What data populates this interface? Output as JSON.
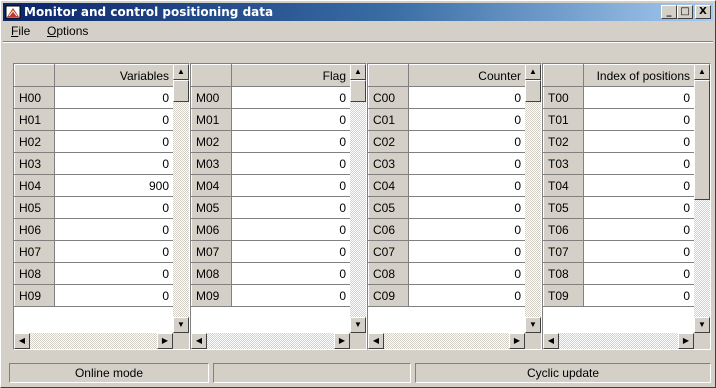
{
  "window": {
    "title": "Monitor and control positioning data",
    "minimize_label": "_",
    "maximize_label": "□",
    "close_label": "X"
  },
  "menu": {
    "file_mnemonic": "F",
    "file_rest": "ile",
    "options_mnemonic": "O",
    "options_rest": "ptions"
  },
  "panels": [
    {
      "header": "Variables",
      "rows": [
        {
          "label": "H00",
          "value": "0"
        },
        {
          "label": "H01",
          "value": "0"
        },
        {
          "label": "H02",
          "value": "0"
        },
        {
          "label": "H03",
          "value": "0"
        },
        {
          "label": "H04",
          "value": "900"
        },
        {
          "label": "H05",
          "value": "0"
        },
        {
          "label": "H06",
          "value": "0"
        },
        {
          "label": "H07",
          "value": "0"
        },
        {
          "label": "H08",
          "value": "0"
        },
        {
          "label": "H09",
          "value": "0"
        }
      ]
    },
    {
      "header": "Flag",
      "rows": [
        {
          "label": "M00",
          "value": "0"
        },
        {
          "label": "M01",
          "value": "0"
        },
        {
          "label": "M02",
          "value": "0"
        },
        {
          "label": "M03",
          "value": "0"
        },
        {
          "label": "M04",
          "value": "0"
        },
        {
          "label": "M05",
          "value": "0"
        },
        {
          "label": "M06",
          "value": "0"
        },
        {
          "label": "M07",
          "value": "0"
        },
        {
          "label": "M08",
          "value": "0"
        },
        {
          "label": "M09",
          "value": "0"
        }
      ]
    },
    {
      "header": "Counter",
      "rows": [
        {
          "label": "C00",
          "value": "0"
        },
        {
          "label": "C01",
          "value": "0"
        },
        {
          "label": "C02",
          "value": "0"
        },
        {
          "label": "C03",
          "value": "0"
        },
        {
          "label": "C04",
          "value": "0"
        },
        {
          "label": "C05",
          "value": "0"
        },
        {
          "label": "C06",
          "value": "0"
        },
        {
          "label": "C07",
          "value": "0"
        },
        {
          "label": "C08",
          "value": "0"
        },
        {
          "label": "C09",
          "value": "0"
        }
      ]
    },
    {
      "header": "Index of positions",
      "rows": [
        {
          "label": "T00",
          "value": "0"
        },
        {
          "label": "T01",
          "value": "0"
        },
        {
          "label": "T02",
          "value": "0"
        },
        {
          "label": "T03",
          "value": "0"
        },
        {
          "label": "T04",
          "value": "0"
        },
        {
          "label": "T05",
          "value": "0"
        },
        {
          "label": "T06",
          "value": "0"
        },
        {
          "label": "T07",
          "value": "0"
        },
        {
          "label": "T08",
          "value": "0"
        },
        {
          "label": "T09",
          "value": "0"
        }
      ]
    }
  ],
  "status": {
    "mode": "Online mode",
    "middle": "",
    "update": "Cyclic update"
  },
  "icons": {
    "app": "monitor-app-icon",
    "scroll_up": "arrow-up-icon",
    "scroll_down": "arrow-down-icon",
    "scroll_left": "arrow-left-icon",
    "scroll_right": "arrow-right-icon"
  },
  "colors": {
    "titlebar_start": "#0a246a",
    "titlebar_end": "#a6caf0",
    "face": "#d4d0c8"
  }
}
